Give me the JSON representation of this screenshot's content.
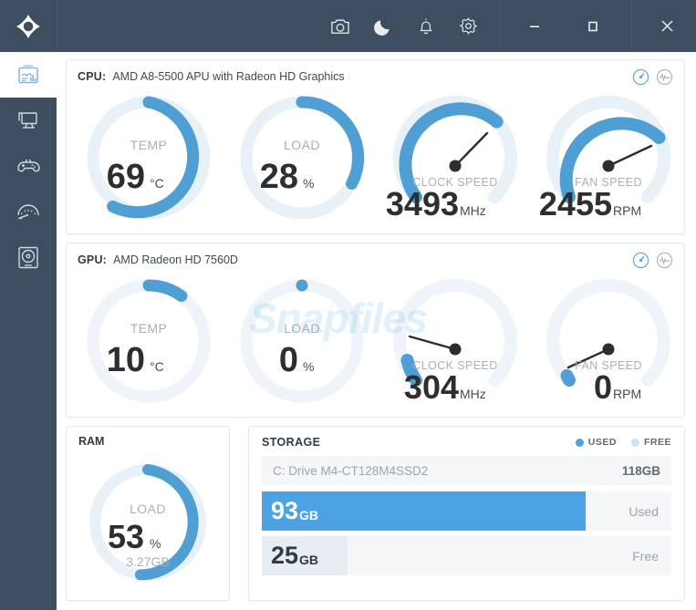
{
  "titlebar": {
    "logo_name": "app-logo",
    "icons": [
      {
        "name": "camera-icon",
        "label": "Screenshot"
      },
      {
        "name": "moon-icon",
        "label": "Night mode"
      },
      {
        "name": "bell-icon",
        "label": "Alerts"
      },
      {
        "name": "gear-icon",
        "label": "Settings"
      }
    ],
    "window_controls": [
      {
        "name": "minimize-button",
        "label": "–"
      },
      {
        "name": "maximize-button",
        "label": "☐"
      },
      {
        "name": "close-button",
        "label": "×"
      }
    ]
  },
  "sidebar": {
    "items": [
      {
        "name": "sidebar-item-dashboard",
        "icon": "report-chart-icon",
        "active": true
      },
      {
        "name": "sidebar-item-desktop",
        "icon": "monitor-icon",
        "active": false
      },
      {
        "name": "sidebar-item-gaming",
        "icon": "gamepad-icon",
        "active": false
      },
      {
        "name": "sidebar-item-benchmark",
        "icon": "gauge-icon",
        "active": false
      },
      {
        "name": "sidebar-item-storage",
        "icon": "disk-drive-icon",
        "active": false
      }
    ]
  },
  "colors": {
    "accent_blue": "#4ba3e3",
    "gauge_blue": "#4f9fd5",
    "gauge_track": "#e8f1f8",
    "titlebar": "#3d4e60",
    "panel_bg": "#ffffff",
    "text_dark": "#2f3b47",
    "text_muted": "#a7b0ba"
  },
  "watermark": "Snapfiles",
  "cpu": {
    "key": "CPU:",
    "name": "AMD A8-5500 APU with Radeon HD Graphics",
    "mode_icons": [
      {
        "name": "gauge-view-icon",
        "active": true
      },
      {
        "name": "graph-view-icon",
        "active": false
      }
    ],
    "gauges": [
      {
        "name": "cpu-temp-gauge",
        "type": "ring",
        "label": "TEMP",
        "value": "69",
        "unit": "°C",
        "percent": 69
      },
      {
        "name": "cpu-load-gauge",
        "type": "ring",
        "label": "LOAD",
        "value": "28",
        "unit": "%",
        "percent": 28
      },
      {
        "name": "cpu-clock-gauge",
        "type": "dial",
        "label": "CLOCK SPEED",
        "value": "3493",
        "unit": "MHz",
        "percent": 85
      },
      {
        "name": "cpu-fan-gauge",
        "type": "dial",
        "label": "FAN SPEED",
        "value": "2455",
        "unit": "RPM",
        "percent": 78
      }
    ]
  },
  "gpu": {
    "key": "GPU:",
    "name": "AMD Radeon HD 7560D",
    "mode_icons": [
      {
        "name": "gauge-view-icon",
        "active": true
      },
      {
        "name": "graph-view-icon",
        "active": false
      }
    ],
    "gauges": [
      {
        "name": "gpu-temp-gauge",
        "type": "ring",
        "label": "TEMP",
        "value": "10",
        "unit": "°C",
        "percent": 10
      },
      {
        "name": "gpu-load-gauge",
        "type": "ring",
        "label": "LOAD",
        "value": "0",
        "unit": "%",
        "percent": 0
      },
      {
        "name": "gpu-clock-gauge",
        "type": "dial",
        "label": "CLOCK SPEED",
        "value": "304",
        "unit": "MHz",
        "percent": 6
      },
      {
        "name": "gpu-fan-gauge",
        "type": "dial",
        "label": "FAN SPEED",
        "value": "0",
        "unit": "RPM",
        "percent": 1
      }
    ]
  },
  "ram": {
    "title": "RAM",
    "gauge": {
      "name": "ram-load-gauge",
      "label": "LOAD",
      "value": "53",
      "unit": "%",
      "sub": "3.27GB",
      "percent": 53
    }
  },
  "storage": {
    "title": "STORAGE",
    "legend": [
      {
        "name": "legend-used",
        "label": "USED",
        "color": "#4ba3e3"
      },
      {
        "name": "legend-free",
        "label": "FREE",
        "color": "#cfe3f2"
      }
    ],
    "drive": {
      "name": "C: Drive M4-CT128M4SSD2",
      "size": "118GB"
    },
    "bars": [
      {
        "name": "storage-used-bar",
        "number": "93",
        "unit": "GB",
        "side_label": "Used",
        "percent": 79
      },
      {
        "name": "storage-free-bar",
        "number": "25",
        "unit": "GB",
        "side_label": "Free",
        "percent": 21
      }
    ]
  }
}
